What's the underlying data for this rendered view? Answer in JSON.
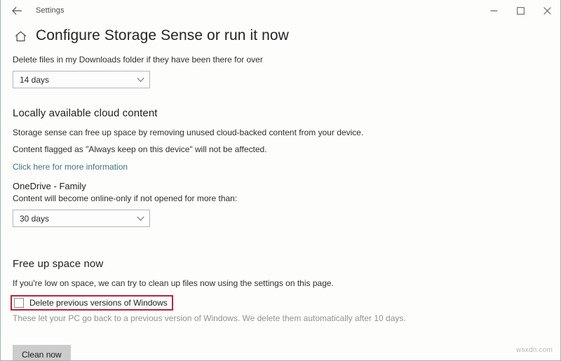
{
  "window": {
    "app_title": "Settings",
    "back_icon": "back-arrow-icon",
    "minimize_label": "Minimize",
    "maximize_label": "Maximize",
    "close_label": "Close"
  },
  "page": {
    "home_icon": "home-icon",
    "title": "Configure Storage Sense or run it now"
  },
  "downloads": {
    "description": "Delete files in my Downloads folder if they have been there for over",
    "dropdown_value": "14 days"
  },
  "cloud": {
    "heading": "Locally available cloud content",
    "paragraph_1": "Storage sense can free up space by removing unused cloud-backed content from your device.",
    "paragraph_2": "Content flagged as \"Always keep on this device\" will not be affected.",
    "link_text": "Click here for more information",
    "link_color": "#46737f",
    "account_label": "OneDrive - Family",
    "account_description": "Content will become online-only if not opened for more than:",
    "dropdown_value": "30 days"
  },
  "free_space": {
    "heading": "Free up space now",
    "description": "If you're low on space, we can try to clean up files now using the settings on this page.",
    "checkbox_label": "Delete previous versions of Windows",
    "checkbox_checked": false,
    "highlight_color": "#b3243b",
    "helper_text": "These let your PC go back to a previous version of Windows. We delete them automatically after 10 days.",
    "clean_button_label": "Clean now"
  },
  "watermark": {
    "text": "wsxdn.com"
  }
}
